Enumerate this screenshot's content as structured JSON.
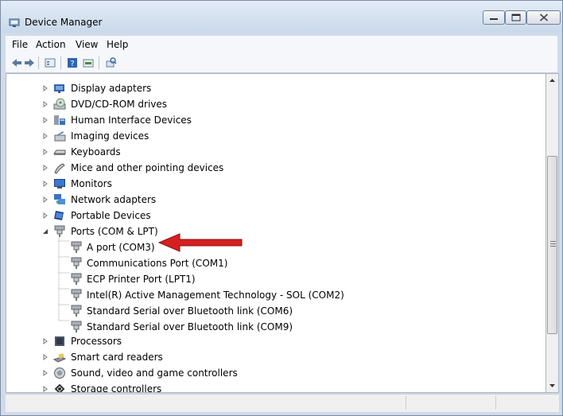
{
  "window": {
    "title": "Device Manager"
  },
  "menubar": {
    "items": [
      "File",
      "Action",
      "View",
      "Help"
    ]
  },
  "toolbar": {
    "buttons": [
      "back-icon",
      "forward-icon",
      "properties-icon",
      "help-icon",
      "update-driver-icon",
      "scan-hardware-icon"
    ]
  },
  "tree": {
    "categories": [
      {
        "label": "Display adapters",
        "icon": "display-adapter-icon",
        "expanded": false
      },
      {
        "label": "DVD/CD-ROM drives",
        "icon": "dvd-drive-icon",
        "expanded": false
      },
      {
        "label": "Human Interface Devices",
        "icon": "hid-icon",
        "expanded": false
      },
      {
        "label": "Imaging devices",
        "icon": "imaging-device-icon",
        "expanded": false
      },
      {
        "label": "Keyboards",
        "icon": "keyboard-icon",
        "expanded": false
      },
      {
        "label": "Mice and other pointing devices",
        "icon": "mouse-icon",
        "expanded": false
      },
      {
        "label": "Monitors",
        "icon": "monitor-icon",
        "expanded": false
      },
      {
        "label": "Network adapters",
        "icon": "network-adapter-icon",
        "expanded": false
      },
      {
        "label": "Portable Devices",
        "icon": "portable-device-icon",
        "expanded": false
      },
      {
        "label": "Ports (COM & LPT)",
        "icon": "port-icon",
        "expanded": true
      },
      {
        "label": "Processors",
        "icon": "processor-icon",
        "expanded": false
      },
      {
        "label": "Smart card readers",
        "icon": "smart-card-icon",
        "expanded": false
      },
      {
        "label": "Sound, video and game controllers",
        "icon": "sound-icon",
        "expanded": false
      },
      {
        "label": "Storage controllers",
        "icon": "storage-controller-icon",
        "expanded": false
      }
    ],
    "ports_children": [
      "A port (COM3)",
      "Communications Port (COM1)",
      "ECP Printer Port (LPT1)",
      "Intel(R) Active Management Technology - SOL (COM2)",
      "Standard Serial over Bluetooth link (COM6)",
      "Standard Serial over Bluetooth link (COM9)"
    ]
  },
  "colors": {
    "arrow": "#cc1111",
    "title_gradient_top": "#e3ecf7",
    "title_gradient_bottom": "#c9d8ea"
  }
}
